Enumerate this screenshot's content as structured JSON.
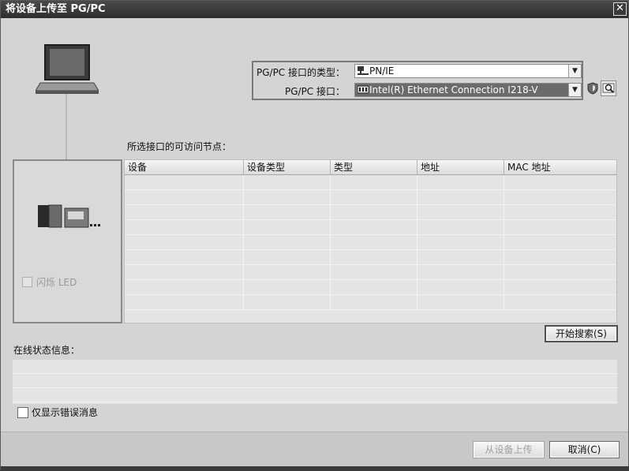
{
  "window": {
    "title": "将设备上传至 PG/PC",
    "close_glyph": "✕"
  },
  "interface": {
    "type_label": "PG/PC 接口的类型：",
    "type_value": "PN/IE",
    "iface_label": "PG/PC 接口：",
    "iface_value": "Intel(R) Ethernet Connection I218-V"
  },
  "nodes": {
    "section_label": "所选接口的可访问节点：",
    "columns": [
      "设备",
      "设备类型",
      "类型",
      "地址",
      "MAC 地址"
    ],
    "rows": []
  },
  "device_panel": {
    "flash_led_label": "闪烁 LED"
  },
  "buttons": {
    "start_search": "开始搜索(S)",
    "upload_from_device": "从设备上传",
    "cancel": "取消(C)"
  },
  "status": {
    "label": "在线状态信息：",
    "show_errors_only": "仅显示错误消息"
  },
  "icons": {
    "pc": "laptop-icon",
    "plc": "plc-device-icon",
    "network": "network-icon",
    "nic": "network-card-icon",
    "shield": "shield-icon",
    "diagnostics": "magnifier-icon"
  }
}
